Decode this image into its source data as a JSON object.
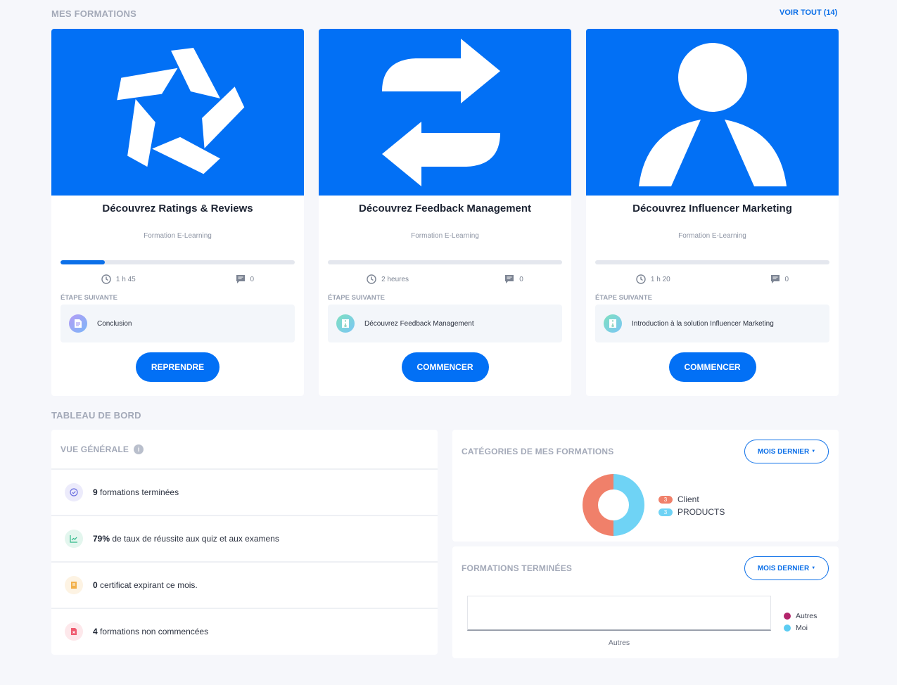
{
  "formations": {
    "title": "MES FORMATIONS",
    "see_all": "VOIR TOUT (14)",
    "cards": [
      {
        "title": "Découvrez Ratings & Reviews",
        "type": "Formation E-Learning",
        "progress": 0.19,
        "duration": "1 h 45",
        "comments": "0",
        "next_label": "ÉTAPE SUIVANTE",
        "next_step": "Conclusion",
        "step_icon": "document-icon",
        "button": "REPRENDRE",
        "hero_icon": "star-pinwheel-icon"
      },
      {
        "title": "Découvrez Feedback Management",
        "type": "Formation E-Learning",
        "progress": 0,
        "duration": "2 heures",
        "comments": "0",
        "next_label": "ÉTAPE SUIVANTE",
        "next_step": "Découvrez Feedback Management",
        "step_icon": "zip-file-icon",
        "button": "COMMENCER",
        "hero_icon": "swap-arrows-icon"
      },
      {
        "title": "Découvrez Influencer Marketing",
        "type": "Formation E-Learning",
        "progress": 0,
        "duration": "1 h 20",
        "comments": "0",
        "next_label": "ÉTAPE SUIVANTE",
        "next_step": "Introduction à la solution Influencer Marketing",
        "step_icon": "zip-file-icon",
        "button": "COMMENCER",
        "hero_icon": "person-icon"
      }
    ]
  },
  "dashboard": {
    "title": "TABLEAU DE BORD",
    "overview": {
      "title": "VUE GÉNÉRALE",
      "info_icon": "i",
      "stats": [
        {
          "value": "9",
          "text": " formations terminées",
          "icon": "check-circle-icon",
          "color": "#6b6fe0",
          "bg": "#ecebfb"
        },
        {
          "value": "79%",
          "text": " de taux de réussite aux quiz et aux examens",
          "icon": "chart-up-icon",
          "color": "#2fb889",
          "bg": "#e3f6ee"
        },
        {
          "value": "0",
          "text": " certificat expirant ce mois.",
          "icon": "certificate-icon",
          "color": "#f2b04a",
          "bg": "#fdf3e3"
        },
        {
          "value": "4",
          "text": " formations non commencées",
          "icon": "file-x-icon",
          "color": "#ef5a6f",
          "bg": "#fde8eb"
        }
      ]
    },
    "categories": {
      "title": "CATÉGORIES DE MES FORMATIONS",
      "filter": "MOIS DERNIER",
      "chart_data": {
        "type": "pie",
        "categories": [
          "Client",
          "PRODUCTS"
        ],
        "values": [
          3,
          3
        ],
        "colors": [
          "#f0806a",
          "#6fd3f5"
        ]
      }
    },
    "completed": {
      "title": "FORMATIONS TERMINÉES",
      "filter": "MOIS DERNIER",
      "chart_data": {
        "type": "bar",
        "categories": [
          "Autres"
        ],
        "series": [
          {
            "name": "Autres",
            "values": [
              0
            ],
            "color": "#b3246b"
          },
          {
            "name": "Moi",
            "values": [
              0
            ],
            "color": "#5cccf2"
          }
        ]
      }
    }
  }
}
